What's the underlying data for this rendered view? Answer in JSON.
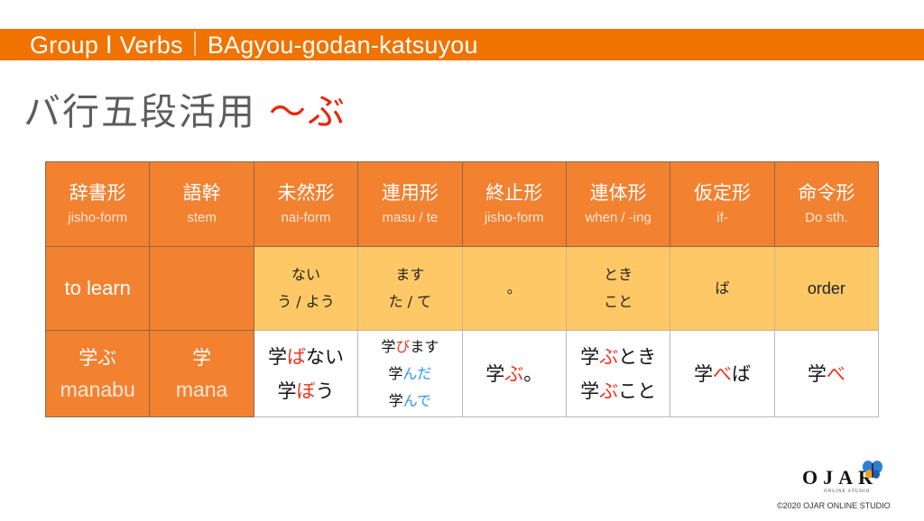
{
  "banner": {
    "text": "Group Ⅰ Verbs｜BAgyou-godan-katsuyou"
  },
  "title": {
    "main": "バ行五段活用",
    "suffix": "～ぶ"
  },
  "colors": {
    "banner": "#f07300",
    "header": "#f28130",
    "meaning_row": "#fdc865",
    "highlight_red": "#f0321b",
    "highlight_blue": "#2c96f0"
  },
  "table": {
    "headers": [
      {
        "jp": "辞書形",
        "en": "jisho-form"
      },
      {
        "jp": "語幹",
        "en": "stem"
      },
      {
        "jp": "未然形",
        "en": "nai-form"
      },
      {
        "jp": "連用形",
        "en": "masu / te"
      },
      {
        "jp": "終止形",
        "en": "jisho-form"
      },
      {
        "jp": "連体形",
        "en": "when / -ing"
      },
      {
        "jp": "仮定形",
        "en": "if-"
      },
      {
        "jp": "命令形",
        "en": "Do sth."
      }
    ],
    "meaning_row": {
      "meaning": "to learn",
      "stem": "",
      "mizen": [
        "ない",
        "う / よう"
      ],
      "renyou": [
        "ます",
        "た / て"
      ],
      "shuushi": "。",
      "rentai": [
        "とき",
        "こと"
      ],
      "katei": "ば",
      "meirei": "order"
    },
    "example_row": {
      "dict_jp": "学ぶ",
      "dict_en": "manabu",
      "stem_jp": "学",
      "stem_en": "mana",
      "mizen": [
        {
          "stem": "学",
          "ending": "ば",
          "rest": "ない"
        },
        {
          "stem": "学",
          "ending": "ぼ",
          "rest": "う"
        }
      ],
      "renyou": [
        {
          "stem": "学",
          "ending": "び",
          "rest": "ます"
        },
        {
          "stem": "学",
          "ending": "んだ",
          "rest": ""
        },
        {
          "stem": "学",
          "ending": "んで",
          "rest": ""
        }
      ],
      "shuushi": {
        "stem": "学",
        "ending": "ぶ",
        "rest": "。"
      },
      "rentai": [
        {
          "stem": "学",
          "ending": "ぶ",
          "rest": "とき"
        },
        {
          "stem": "学",
          "ending": "ぶ",
          "rest": "こと"
        }
      ],
      "katei": {
        "stem": "学",
        "ending": "べ",
        "rest": "ば"
      },
      "meirei": {
        "stem": "学",
        "ending": "べ",
        "rest": ""
      }
    }
  },
  "footer": {
    "logo_text": "OJAR",
    "logo_sub": "ONLINE STUDIO",
    "copyright": "©2020 OJAR ONLINE STUDIO"
  }
}
